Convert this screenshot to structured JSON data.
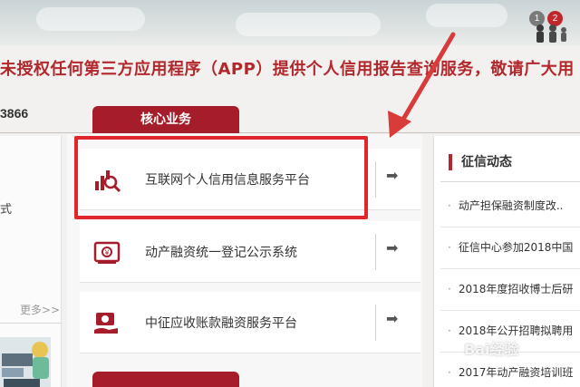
{
  "header": {
    "badge_left": "1",
    "badge_right": "2"
  },
  "notice": {
    "text": "未授权任何第三方应用程序（APP）提供个人信用报告查询服务，敬请广大用"
  },
  "contact": {
    "phone_fragment": "3866"
  },
  "left_column": {
    "text_fragment": "式",
    "more_label": "更多>>"
  },
  "core_business": {
    "tab_label": "核心业务",
    "services": [
      {
        "label": "互联网个人信用信息服务平台",
        "icon": "magnifier-chart-icon",
        "arrow": "➡"
      },
      {
        "label": "动产融资统一登记公示系统",
        "icon": "money-document-icon",
        "arrow": "➡"
      },
      {
        "label": "中征应收账款融资服务平台",
        "icon": "coins-hand-icon",
        "arrow": "➡"
      }
    ]
  },
  "news": {
    "title": "征信动态",
    "items": [
      "动产担保融资制度改..",
      "征信中心参加2018中国",
      "2018年度招收博士后研",
      "2018年公开招聘拟聘用",
      "2017年动产融资培训班"
    ]
  },
  "watermark": {
    "text": "Bai经验"
  },
  "colors": {
    "brand_red": "#a51d2a",
    "highlight_red": "#e0252d",
    "notice_red": "#b3282d"
  }
}
